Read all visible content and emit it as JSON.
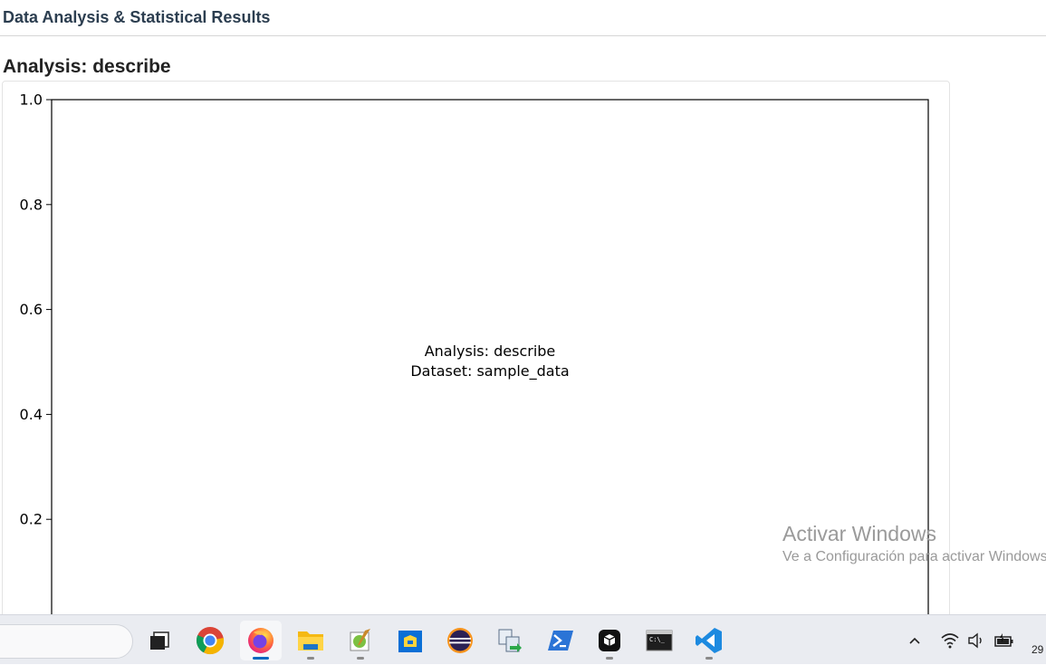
{
  "header": {
    "title": "Data Analysis & Statistical Results"
  },
  "section": {
    "title": "Analysis: describe"
  },
  "chart_data": {
    "type": "scatter",
    "series": [],
    "ylim": [
      0.0,
      1.0
    ],
    "y_ticks": [
      "1.0",
      "0.8",
      "0.6",
      "0.4",
      "0.2"
    ],
    "y_tick_values": [
      1.0,
      0.8,
      0.6,
      0.4,
      0.2
    ],
    "annotation_lines": [
      "Analysis: describe",
      "Dataset: sample_data"
    ],
    "grid": false
  },
  "watermark": {
    "title": "Activar Windows",
    "subtitle": "Ve a Configuración para activar Windows."
  },
  "taskbar": {
    "apps": [
      {
        "name": "task-view-icon"
      },
      {
        "name": "chrome-icon"
      },
      {
        "name": "firefox-icon"
      },
      {
        "name": "file-explorer-icon"
      },
      {
        "name": "notepad-plus-plus-icon"
      },
      {
        "name": "store-icon"
      },
      {
        "name": "eclipse-icon"
      },
      {
        "name": "transfer-icon"
      },
      {
        "name": "powershell-icon"
      },
      {
        "name": "app-cube-icon"
      },
      {
        "name": "terminal-icon"
      },
      {
        "name": "vscode-icon"
      }
    ],
    "clock": "29"
  }
}
